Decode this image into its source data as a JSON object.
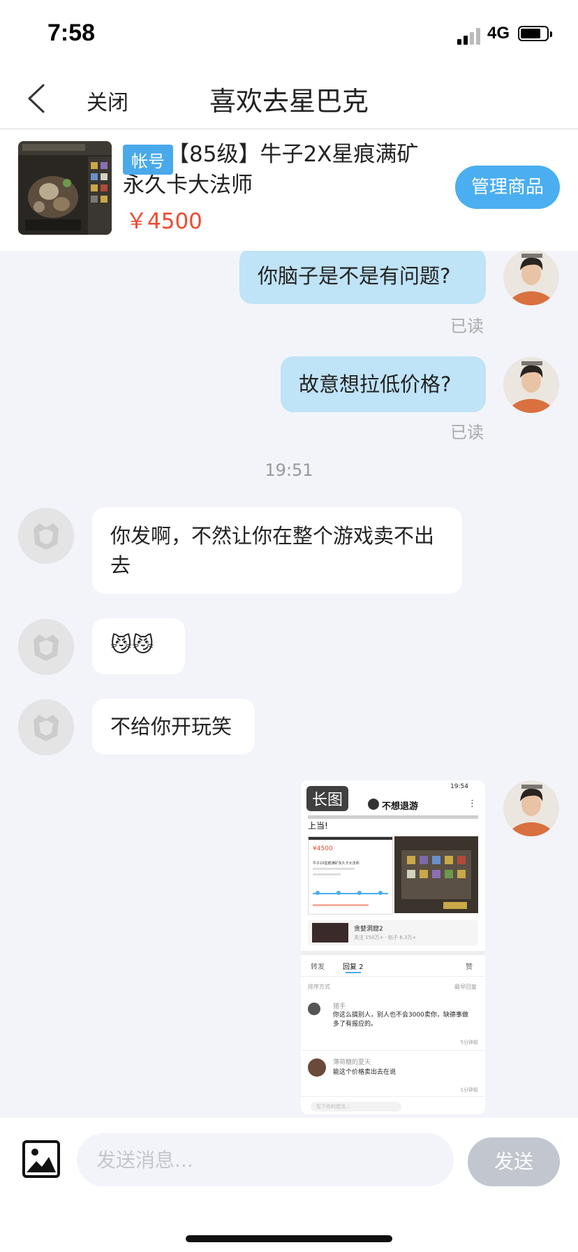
{
  "status_bar": {
    "time": "7:58",
    "network": "4G"
  },
  "nav": {
    "close_label": "关闭",
    "title": "喜欢去星巴克"
  },
  "product": {
    "tag": "帐号",
    "title": "【85级】牛子2X星痕满矿永久卡大法师",
    "price": "￥4500",
    "manage_label": "管理商品"
  },
  "messages": [
    {
      "sender": "me",
      "text": "你脑子是不是有问题?",
      "status": "已读"
    },
    {
      "sender": "me",
      "text": "故意想拉低价格?",
      "status": "已读"
    },
    {
      "sender": "system",
      "text": "19:51"
    },
    {
      "sender": "other",
      "text": "你发啊，不然让你在整个游戏卖不出去"
    },
    {
      "sender": "other",
      "text": "😼😼"
    },
    {
      "sender": "other",
      "text": "不给你开玩笑"
    },
    {
      "sender": "me",
      "type": "image",
      "tag": "长图"
    }
  ],
  "screenshot": {
    "time": "19:54",
    "group": "不想退游",
    "post_line": "上当!",
    "price": "¥4500",
    "card_title": "牛子2X星痕满矿永久卡大法师",
    "forum_name": "贪婪洞窟2",
    "forum_stats": "关注 150万+ · 帖子 6.3万+",
    "tabs": [
      "转发",
      "回复 2",
      "赞"
    ],
    "sort_label": "排序方式",
    "sort_value": "最早回复",
    "replies": [
      {
        "user": "猎手",
        "text": "你这么搞别人，别人也不会3000卖你，缺德事做多了有报应的。",
        "time": "5分钟前"
      },
      {
        "user": "薄荷糖的夏天",
        "text": "能这个价格卖出去在说",
        "time": "1分钟前"
      }
    ],
    "reply_placeholder": "写下你的想法..."
  },
  "input": {
    "placeholder": "发送消息...",
    "send_label": "发送"
  },
  "colors": {
    "accent": "#4aaef0",
    "price": "#f04a2f",
    "my_bubble": "#bfe3f7",
    "background": "#f2f4f9",
    "send_disabled": "#c2c6ce"
  },
  "icons": [
    "back-arrow-icon",
    "signal-icon",
    "battery-icon",
    "image-icon",
    "default-avatar-icon"
  ]
}
